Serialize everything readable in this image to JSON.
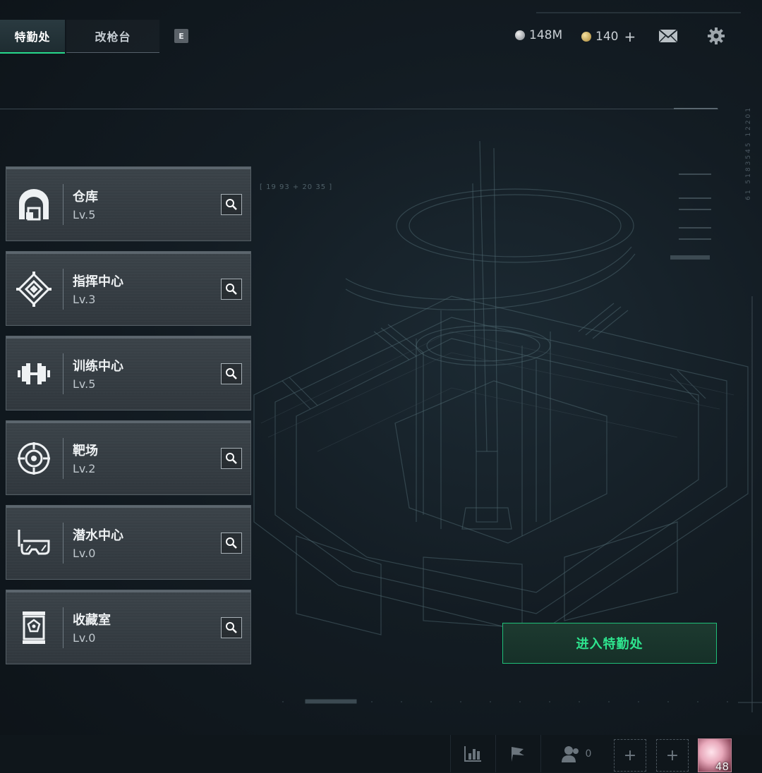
{
  "tabs": {
    "active": "特勤处",
    "inactive": "改枪台",
    "key_hint": "E"
  },
  "currency": {
    "silver": "148M",
    "gold": "140",
    "gold_plus": "+"
  },
  "icons": {
    "mail": "mail-icon",
    "settings": "gear-icon"
  },
  "facilities": [
    {
      "name": "仓库",
      "level": "Lv.5",
      "icon": "warehouse-icon"
    },
    {
      "name": "指挥中心",
      "level": "Lv.3",
      "icon": "command-center-icon"
    },
    {
      "name": "训练中心",
      "level": "Lv.5",
      "icon": "dumbbell-icon"
    },
    {
      "name": "靶场",
      "level": "Lv.2",
      "icon": "target-icon"
    },
    {
      "name": "潜水中心",
      "level": "Lv.0",
      "icon": "diving-mask-icon"
    },
    {
      "name": "收藏室",
      "level": "Lv.0",
      "icon": "collection-case-icon"
    }
  ],
  "enter_button": "进入特勤处",
  "hud": {
    "coord_text": "[ 19 93 + 20 35 ]",
    "side_text": "61 5183545 12201"
  },
  "bottom_bar": {
    "friends_count": "0",
    "slot_symbol": "+",
    "avatar_level": "48"
  },
  "colors": {
    "accent_green": "#27d98c",
    "background": "#131c23"
  }
}
